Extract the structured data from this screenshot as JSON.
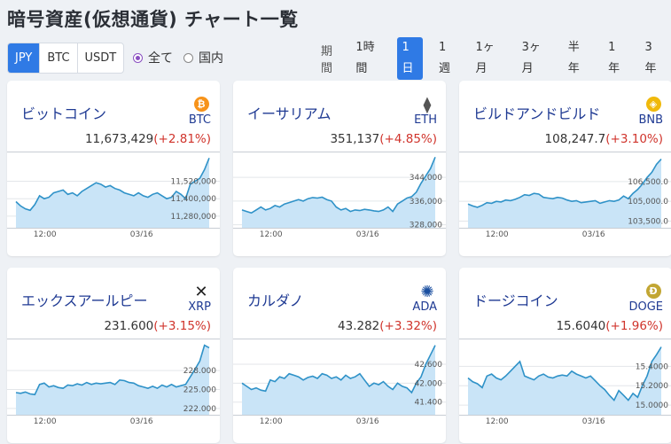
{
  "page_title": "暗号資産(仮想通貨) チャート一覧",
  "currency_tabs": [
    {
      "label": "JPY",
      "active": true
    },
    {
      "label": "BTC",
      "active": false
    },
    {
      "label": "USDT",
      "active": false
    }
  ],
  "market_filter": [
    {
      "label": "全て",
      "checked": true
    },
    {
      "label": "国内",
      "checked": false
    }
  ],
  "period_label": "期間",
  "periods": [
    {
      "label": "1時間",
      "active": false
    },
    {
      "label": "1日",
      "active": true
    },
    {
      "label": "1週",
      "active": false
    },
    {
      "label": "1ヶ月",
      "active": false
    },
    {
      "label": "3ヶ月",
      "active": false
    },
    {
      "label": "半年",
      "active": false
    },
    {
      "label": "1年",
      "active": false
    },
    {
      "label": "3年",
      "active": false
    }
  ],
  "colors": {
    "accent": "#2f7ae5",
    "change_up": "#d0342c",
    "line": "#2f92c8",
    "fill": "#c9e4f7",
    "name": "#1f3a93"
  },
  "cards": [
    {
      "name": "ビットコイン",
      "symbol": "BTC",
      "icon": "bitcoin-icon",
      "icon_glyph": "₿",
      "icon_color": "#f7931a",
      "price": "11,673,429",
      "change": "(+2.81%)",
      "chart_data": {
        "type": "area",
        "ylim": [
          11200000,
          11700000
        ],
        "yticks": [
          "11,520,000",
          "11,400,000",
          "11,280,000"
        ],
        "ytick_values": [
          11520000,
          11400000,
          11280000
        ],
        "xticks": [
          "12:00",
          "03/16"
        ],
        "xtick_fractions": [
          0.15,
          0.65
        ],
        "values": [
          11380000,
          11350000,
          11330000,
          11320000,
          11360000,
          11420000,
          11400000,
          11410000,
          11440000,
          11450000,
          11460000,
          11430000,
          11440000,
          11420000,
          11450000,
          11470000,
          11490000,
          11510000,
          11500000,
          11480000,
          11490000,
          11470000,
          11460000,
          11440000,
          11430000,
          11420000,
          11440000,
          11420000,
          11410000,
          11430000,
          11440000,
          11420000,
          11400000,
          11410000,
          11450000,
          11430000,
          11400000,
          11500000,
          11520000,
          11540000,
          11600000,
          11680000
        ]
      }
    },
    {
      "name": "イーサリアム",
      "symbol": "ETH",
      "icon": "ethereum-icon",
      "icon_glyph": "⧫",
      "icon_color": "#555555",
      "price": "351,137",
      "change": "(+4.85%)",
      "chart_data": {
        "type": "area",
        "ylim": [
          327000,
          351500
        ],
        "yticks": [
          "344,000",
          "336,000",
          "328,000"
        ],
        "ytick_values": [
          344000,
          336000,
          328000
        ],
        "xticks": [
          "12:00",
          "03/16"
        ],
        "xtick_fractions": [
          0.15,
          0.65
        ],
        "values": [
          333000,
          332500,
          332000,
          333000,
          334000,
          333000,
          333500,
          334500,
          334000,
          335000,
          335500,
          336000,
          336500,
          336000,
          336800,
          337200,
          337000,
          337300,
          336500,
          336000,
          334000,
          333000,
          333500,
          332500,
          333000,
          332800,
          333200,
          333000,
          332700,
          332500,
          333000,
          334000,
          332500,
          335000,
          336000,
          337000,
          337500,
          339000,
          342000,
          344500,
          347000,
          350800
        ]
      }
    },
    {
      "name": "ビルドアンドビルド",
      "symbol": "BNB",
      "icon": "bnb-icon",
      "icon_glyph": "◈",
      "icon_color": "#f0b90b",
      "price": "108,247.7",
      "change": "(+3.10%)",
      "chart_data": {
        "type": "area",
        "ylim": [
          103000,
          108500
        ],
        "yticks": [
          "106,500.0",
          "105,000.0",
          "103,500.0"
        ],
        "ytick_values": [
          106500,
          105000,
          103500
        ],
        "xticks": [
          "12:00",
          "03/16"
        ],
        "xtick_fractions": [
          0.15,
          0.65
        ],
        "values": [
          104800,
          104650,
          104550,
          104700,
          104900,
          104850,
          105000,
          104950,
          105100,
          105050,
          105150,
          105300,
          105500,
          105450,
          105600,
          105550,
          105300,
          105250,
          105200,
          105300,
          105250,
          105100,
          105000,
          105050,
          104900,
          104950,
          105000,
          105050,
          104850,
          104950,
          105050,
          105000,
          105100,
          105400,
          105200,
          105600,
          105900,
          106300,
          106800,
          107200,
          107800,
          108200
        ]
      }
    },
    {
      "name": "エックスアールピー",
      "symbol": "XRP",
      "icon": "xrp-icon",
      "icon_glyph": "✕",
      "icon_color": "#222222",
      "price": "231.600",
      "change": "(+3.15%)",
      "chart_data": {
        "type": "area",
        "ylim": [
          221000,
          232500
        ],
        "yticks": [
          "228.000",
          "225.000",
          "222.000"
        ],
        "ytick_values": [
          228000,
          225000,
          222000
        ],
        "xticks": [
          "12:00",
          "03/16"
        ],
        "xtick_fractions": [
          0.15,
          0.65
        ],
        "values": [
          224500,
          224400,
          224600,
          224300,
          224200,
          225800,
          226000,
          225400,
          225600,
          225300,
          225200,
          225700,
          225600,
          225900,
          225700,
          226100,
          225800,
          226000,
          225900,
          226000,
          226100,
          225800,
          226500,
          226400,
          226100,
          226000,
          225600,
          225400,
          225200,
          225500,
          225200,
          225700,
          225400,
          225800,
          225400,
          225600,
          225800,
          227000,
          228200,
          229500,
          232000,
          231600
        ]
      }
    },
    {
      "name": "カルダノ",
      "symbol": "ADA",
      "icon": "cardano-icon",
      "icon_glyph": "✺",
      "icon_color": "#1a4fa0",
      "price": "43.282",
      "change": "(+3.32%)",
      "chart_data": {
        "type": "area",
        "ylim": [
          41000,
          43300
        ],
        "yticks": [
          "42.600",
          "42.000",
          "41.400"
        ],
        "ytick_values": [
          42600,
          42000,
          41400
        ],
        "xticks": [
          "12:00",
          "03/16"
        ],
        "xtick_fractions": [
          0.15,
          0.65
        ],
        "values": [
          42000,
          41900,
          41800,
          41850,
          41780,
          41750,
          42100,
          42050,
          42200,
          42150,
          42300,
          42250,
          42200,
          42100,
          42180,
          42220,
          42150,
          42300,
          42250,
          42150,
          42200,
          42100,
          42250,
          42150,
          42200,
          42300,
          42100,
          41900,
          42000,
          41950,
          42050,
          41900,
          41800,
          42000,
          41900,
          41850,
          41700,
          42000,
          42200,
          42600,
          42900,
          43200
        ]
      }
    },
    {
      "name": "ドージコイン",
      "symbol": "DOGE",
      "icon": "dogecoin-icon",
      "icon_glyph": "Ð",
      "icon_color": "#c2a633",
      "price": "15.6040",
      "change": "(+1.96%)",
      "chart_data": {
        "type": "area",
        "ylim": [
          14900,
          15650
        ],
        "yticks": [
          "15.4000",
          "15.2000",
          "15.0000"
        ],
        "ytick_values": [
          15400,
          15200,
          15000
        ],
        "xticks": [
          "12:00",
          "03/16"
        ],
        "xtick_fractions": [
          0.15,
          0.65
        ],
        "values": [
          15280,
          15240,
          15220,
          15180,
          15300,
          15320,
          15280,
          15260,
          15300,
          15350,
          15400,
          15450,
          15300,
          15280,
          15260,
          15300,
          15320,
          15290,
          15280,
          15300,
          15310,
          15300,
          15350,
          15320,
          15300,
          15280,
          15300,
          15250,
          15200,
          15160,
          15100,
          15050,
          15150,
          15100,
          15050,
          15120,
          15080,
          15200,
          15300,
          15450,
          15520,
          15600
        ]
      }
    }
  ]
}
